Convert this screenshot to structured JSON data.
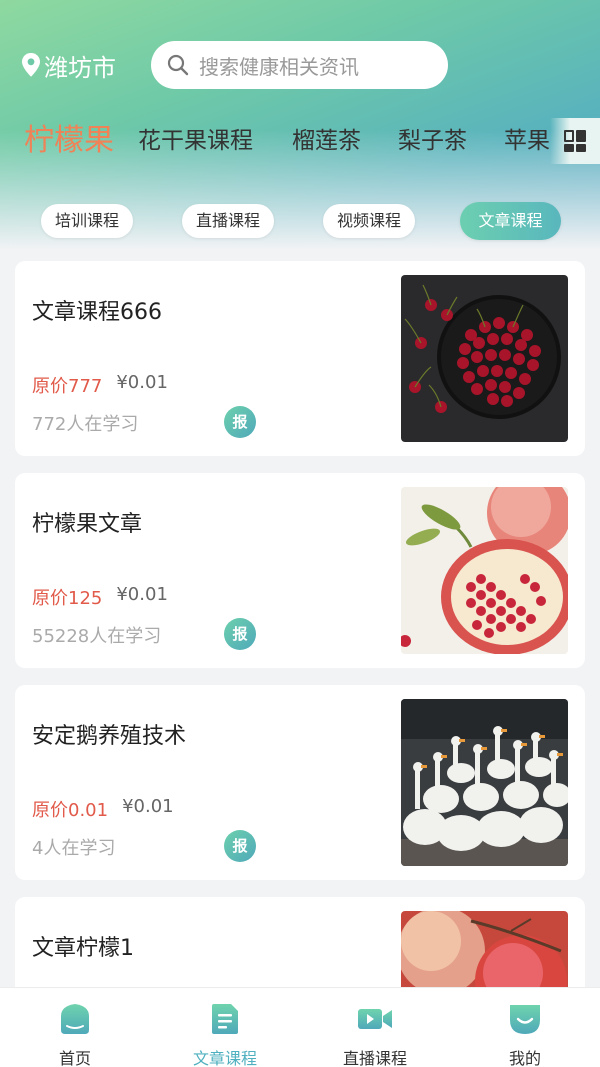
{
  "header": {
    "city": "潍坊市",
    "search_placeholder": "搜索健康相关资讯"
  },
  "categories": [
    "柠檬果",
    "花干果课程",
    "榴莲茶",
    "梨子茶",
    "苹果"
  ],
  "filters": [
    "培训课程",
    "直播课程",
    "视频课程",
    "文章课程"
  ],
  "active_filter": "文章课程",
  "courses": [
    {
      "title": "文章课程666",
      "orig_price": "原价777",
      "price": "¥0.01",
      "learners": "772人在学习",
      "badge": "报",
      "image": "cherries-photo"
    },
    {
      "title": "柠檬果文章",
      "orig_price": "原价125",
      "price": "¥0.01",
      "learners": "55228人在学习",
      "badge": "报",
      "image": "pomegranate-photo"
    },
    {
      "title": "安定鹅养殖技术",
      "orig_price": "原价0.01",
      "price": "¥0.01",
      "learners": "4人在学习",
      "badge": "报",
      "image": "geese-photo"
    },
    {
      "title": "文章柠檬1",
      "orig_price": "",
      "price": "",
      "learners": "",
      "badge": "",
      "image": "lychee-photo"
    }
  ],
  "tabbar": [
    {
      "label": "首页",
      "icon": "home-icon"
    },
    {
      "label": "文章课程",
      "icon": "article-icon"
    },
    {
      "label": "直播课程",
      "icon": "video-camera-icon"
    },
    {
      "label": "我的",
      "icon": "profile-icon"
    }
  ],
  "colors": {
    "accent": "#4fb0bf",
    "category_active": "#f08257",
    "orig_price": "#e15a4a"
  }
}
